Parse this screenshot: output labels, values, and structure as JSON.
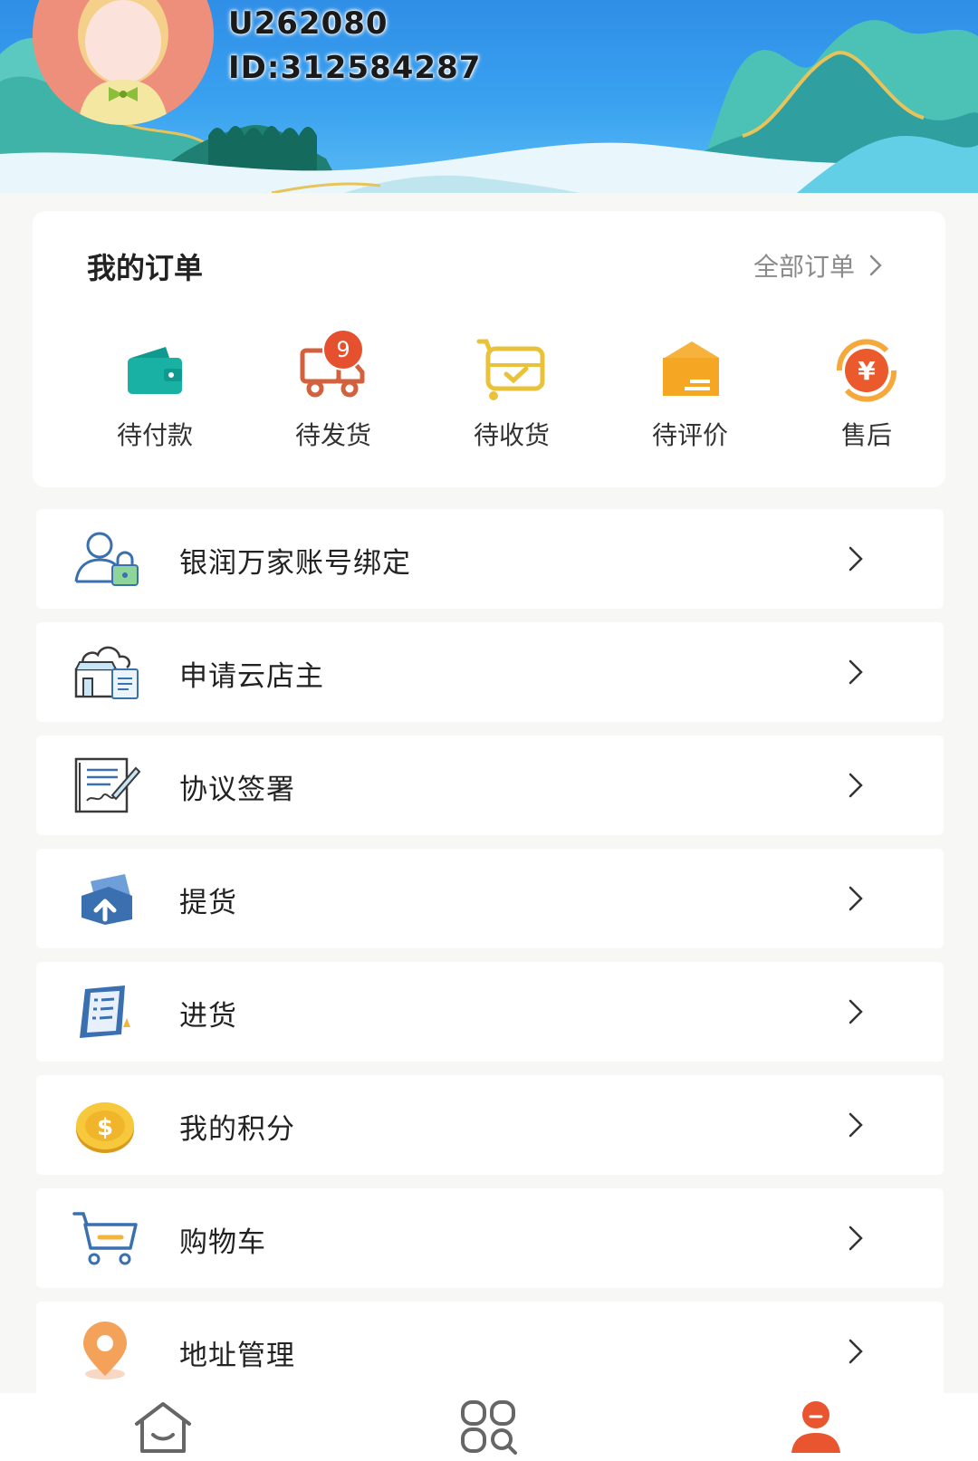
{
  "user": {
    "name": "U262080",
    "id": "ID:312584287"
  },
  "orders": {
    "title": "我的订单",
    "all_orders_label": "全部订单",
    "items": [
      {
        "label": "待付款",
        "icon": "wallet-icon"
      },
      {
        "label": "待发货",
        "icon": "truck-icon",
        "badge": "9"
      },
      {
        "label": "待收货",
        "icon": "cart-check-icon"
      },
      {
        "label": "待评价",
        "icon": "package-icon"
      },
      {
        "label": "售后",
        "icon": "yen-refund-icon"
      }
    ]
  },
  "menu": [
    {
      "label": "银润万家账号绑定",
      "icon": "account-lock-icon"
    },
    {
      "label": "申请云店主",
      "icon": "cloud-store-icon"
    },
    {
      "label": "协议签署",
      "icon": "contract-sign-icon"
    },
    {
      "label": "提货",
      "icon": "pickup-upload-icon"
    },
    {
      "label": "进货",
      "icon": "purchase-list-icon"
    },
    {
      "label": "我的积分",
      "icon": "coin-icon"
    },
    {
      "label": "购物车",
      "icon": "shopping-cart-icon"
    },
    {
      "label": "地址管理",
      "icon": "location-pin-icon"
    }
  ],
  "bottom_nav": [
    {
      "icon": "home-icon"
    },
    {
      "icon": "category-icon"
    },
    {
      "icon": "profile-icon",
      "active": true
    }
  ],
  "colors": {
    "accent": "#e9552f",
    "badge": "#e5502e",
    "sky": "#3aa2f0"
  }
}
